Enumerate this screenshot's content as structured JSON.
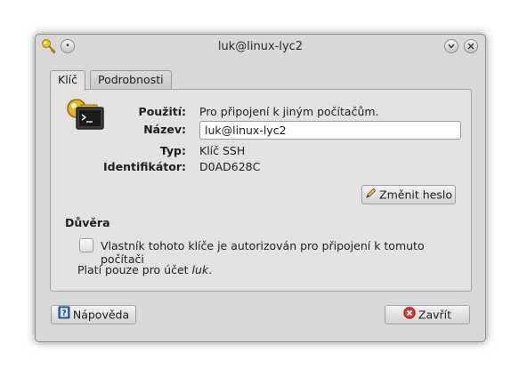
{
  "window": {
    "title": "luk@linux-lyc2"
  },
  "titlebar": {
    "app_icon": "key-icon",
    "left_button_icon": "dot-icon",
    "minimize_icon": "chevron-down-icon",
    "close_icon": "close-icon"
  },
  "tabs": [
    {
      "label": "Klíč",
      "active": true
    },
    {
      "label": "Podrobnosti",
      "active": false
    }
  ],
  "key": {
    "icon": "ssh-key-terminal-icon",
    "usage_label": "Použití:",
    "usage_value": "Pro připojení k jiným počítačům.",
    "name_label": "Název:",
    "name_value": "luk@linux-lyc2",
    "type_label": "Typ:",
    "type_value": "Klíč SSH",
    "id_label": "Identifikátor:",
    "id_value": "D0AD628C",
    "change_password_label": "Změnit heslo",
    "change_password_icon": "pencil-icon"
  },
  "trust": {
    "title": "Důvěra",
    "checkbox_label": "Vlastník tohoto klíče je autorizován pro připojení k tomuto počítači",
    "checkbox_checked": false,
    "note_prefix": "Platí pouze pro účet ",
    "note_account": "luk",
    "note_suffix": "."
  },
  "footer": {
    "help_label": "Nápověda",
    "help_icon": "help-book-icon",
    "close_label": "Zavřít",
    "close_icon": "close-circle-icon"
  },
  "colors": {
    "window_bg": "#d9d8d6",
    "panel_bg": "#e3e2e0",
    "close_red": "#d83a2e",
    "key_gold": "#e0b52a"
  }
}
